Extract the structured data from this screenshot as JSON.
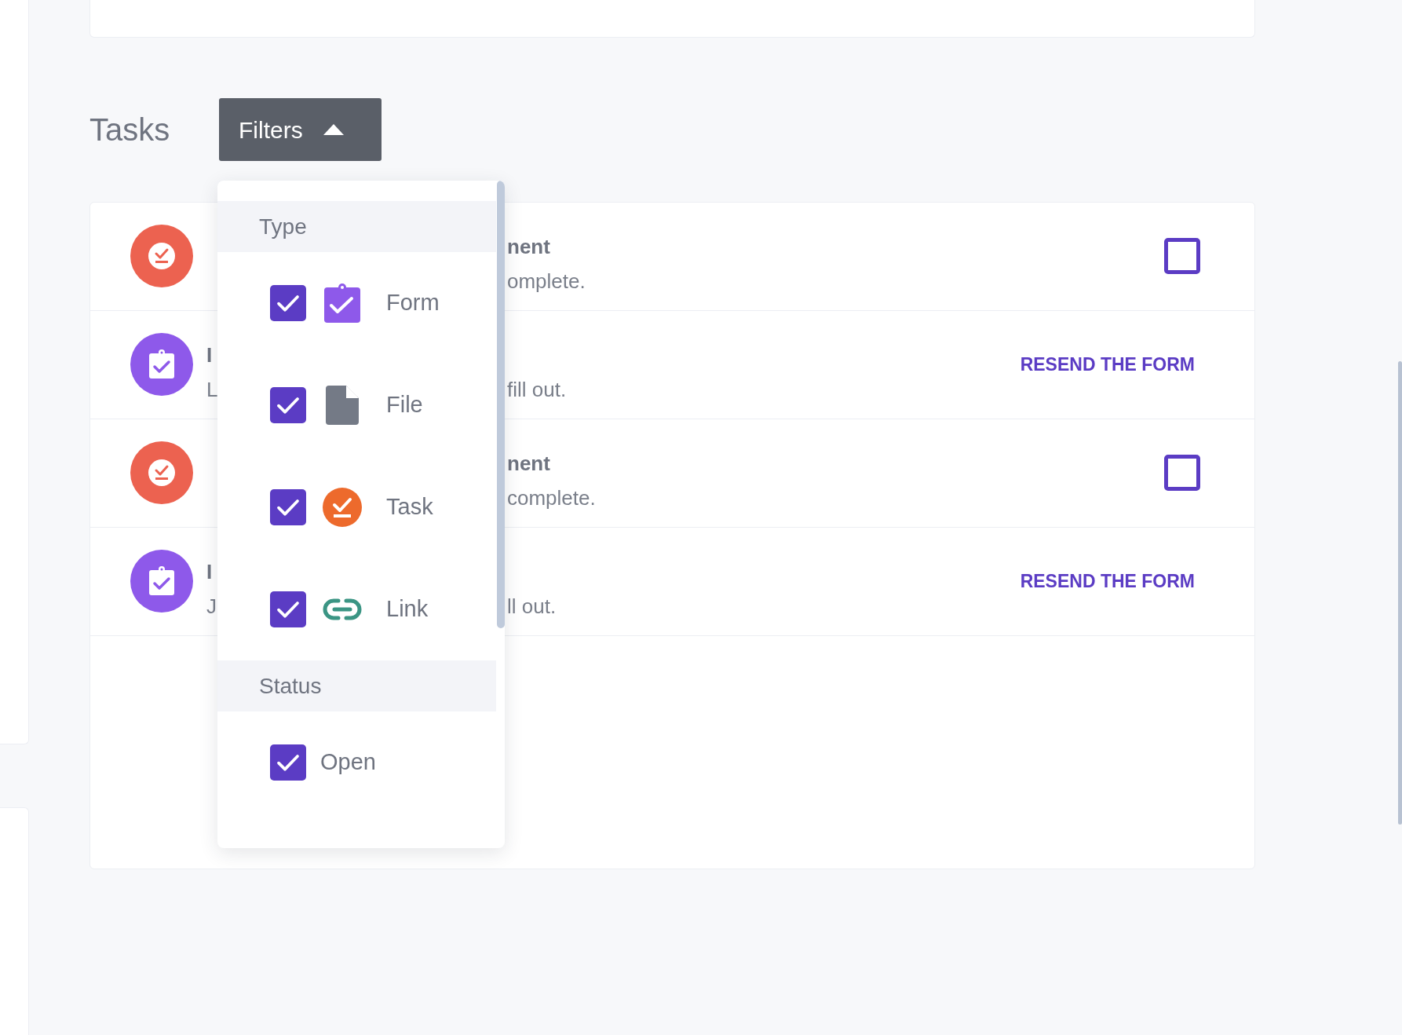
{
  "heading": "Tasks",
  "filters_button": {
    "label": "Filters",
    "expanded": true
  },
  "tasks": [
    {
      "kind": "task",
      "title_right": "nent",
      "description_right": "omplete.",
      "action": {
        "kind": "checkbox",
        "checked": false
      }
    },
    {
      "kind": "form",
      "title_left": "I",
      "description_left": "L",
      "description_right": "fill out.",
      "action": {
        "kind": "link",
        "label": "RESEND THE FORM"
      }
    },
    {
      "kind": "task",
      "title_right": "nent",
      "description_right": "complete.",
      "action": {
        "kind": "checkbox",
        "checked": false
      }
    },
    {
      "kind": "form",
      "title_left": "I",
      "description_left": "J",
      "description_right": "ll out.",
      "action": {
        "kind": "link",
        "label": "RESEND THE FORM"
      }
    }
  ],
  "filter_menu": {
    "sections": [
      {
        "title": "Type",
        "options": [
          {
            "label": "Form",
            "checked": true,
            "kind": "form"
          },
          {
            "label": "File",
            "checked": true,
            "kind": "file"
          },
          {
            "label": "Task",
            "checked": true,
            "kind": "task"
          },
          {
            "label": "Link",
            "checked": true,
            "kind": "link"
          }
        ]
      },
      {
        "title": "Status",
        "options": [
          {
            "label": "Open",
            "checked": true
          }
        ]
      }
    ]
  }
}
